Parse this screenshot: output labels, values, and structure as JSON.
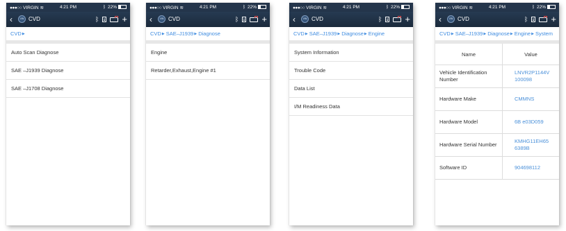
{
  "status_bar": {
    "carrier": "VIRGIN",
    "time": "4:21 PM",
    "battery": "22%"
  },
  "nav": {
    "title": "CVD",
    "vin_badge": "VIN"
  },
  "screens": [
    {
      "breadcrumb": [
        "CVD"
      ],
      "items": [
        "Auto Scan Diagnose",
        "SAE –J1939 Diagnose",
        "SAE –J1708 Diagnose"
      ]
    },
    {
      "breadcrumb": [
        "CVD",
        "SAE–J1939",
        "Diagnose"
      ],
      "items": [
        "Engine",
        "Retarder,Exhaust,Engine #1"
      ]
    },
    {
      "breadcrumb": [
        "CVD",
        "SAE–J1939",
        "Diagnose",
        "Engine"
      ],
      "items": [
        "System Information",
        "Trouble Code",
        "Data List",
        "I/M Readiness Data"
      ]
    },
    {
      "breadcrumb": [
        "CVD",
        "SAE–J1939",
        "Diagnose",
        "Engine",
        "System"
      ],
      "table": {
        "headers": [
          "Name",
          "Value"
        ],
        "rows": [
          {
            "name": "Vehicle Identification Number",
            "value": "LNVR2P1144V 100098"
          },
          {
            "name": "Hardware Make",
            "value": "CMMNS"
          },
          {
            "name": "Hardware Model",
            "value": "6B e03D059"
          },
          {
            "name": "Hardware Serial Number",
            "value": "KMHG11EH65 6389B"
          },
          {
            "name": "Software ID",
            "value": "904698112"
          }
        ]
      }
    }
  ],
  "icons": {
    "back": "back-chevron-icon",
    "bluetooth": "bluetooth-icon",
    "report": "report-document-icon",
    "vehicle": "vehicle-icon",
    "add": "plus-icon"
  },
  "colors": {
    "header": "#24354b",
    "link": "#3f8ce0",
    "value": "#4a90d9",
    "divider": "#e7e7e7"
  }
}
